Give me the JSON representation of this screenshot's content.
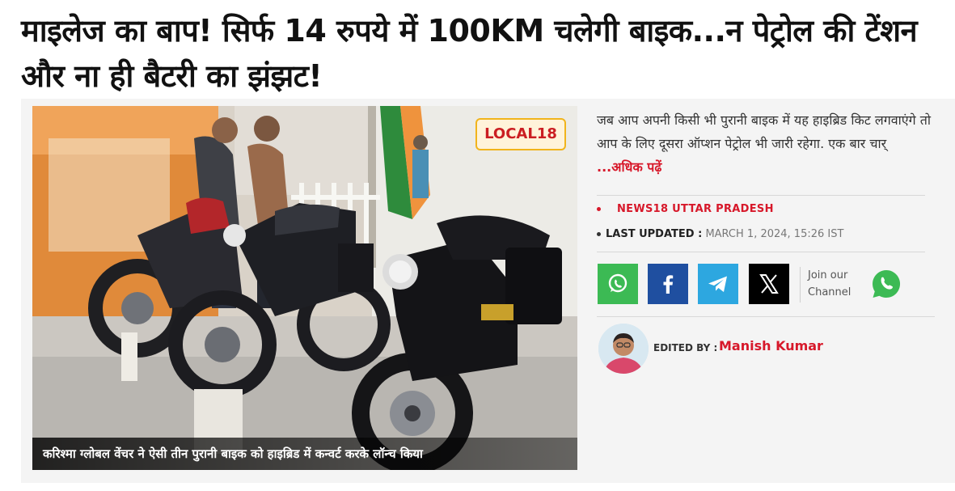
{
  "article": {
    "headline": "माइलेज का बाप! सिर्फ 14 रुपये में 100KM चलेगी बाइक...न पेट्रोल की टेंशन और ना ही बैटरी का झंझट!",
    "summary": "जब आप अपनी किसी भी पुरानी बाइक में यह हाइब्रिड किट लगवाएंगे तो आप के लिए दूसरा ऑप्शन पेट्रोल भी जारी रहेगा. एक बार चार्",
    "read_more": "...अधिक पढ़ें"
  },
  "media": {
    "caption": "करिश्मा ग्लोबल वेंचर ने ऐसी तीन पुरानी बाइक को हाइब्रिड में कन्वर्ट करके लॉन्च किया",
    "logo_text": "LOCAL18"
  },
  "meta": {
    "source": "NEWS18 UTTAR PRADESH",
    "last_updated_label": "LAST UPDATED :",
    "last_updated_value": "MARCH 1, 2024, 15:26 IST"
  },
  "share": {
    "buttons": [
      {
        "icon": "whatsapp-icon",
        "color": "#3cba54"
      },
      {
        "icon": "facebook-icon",
        "color": "#1f4fa0"
      },
      {
        "icon": "telegram-icon",
        "color": "#2da7e0"
      },
      {
        "icon": "x-icon",
        "color": "#000000"
      }
    ],
    "join_line1": "Join our",
    "join_line2": "Channel"
  },
  "author": {
    "edited_by_label": "EDITED BY :",
    "name": "Manish Kumar"
  },
  "colors": {
    "accent": "#d7182a",
    "whatsapp": "#3cba54",
    "facebook": "#1f4fa0",
    "telegram": "#2da7e0"
  }
}
